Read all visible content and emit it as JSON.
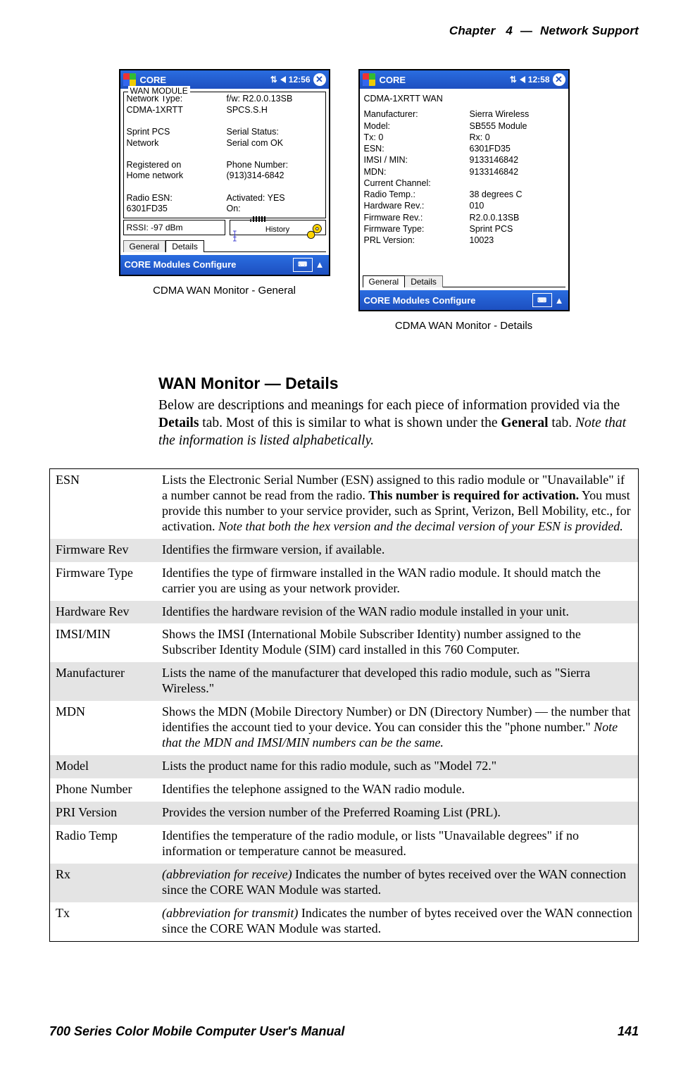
{
  "header": {
    "chapter_label": "Chapter",
    "chapter_num": "4",
    "dash": "—",
    "section": "Network Support"
  },
  "shots": {
    "general": {
      "titlebar": "CORE",
      "time": "12:56",
      "group_title": "WAN MODULE",
      "left_lines": [
        "Network Type:",
        "CDMA-1XRTT",
        "",
        "Sprint PCS",
        "Network",
        "",
        "Registered on",
        "Home network",
        "",
        "Radio ESN:",
        "6301FD35"
      ],
      "right_lines": [
        "f/w: R2.0.0.13SB",
        "    SPCS.S.H",
        "",
        "Serial Status:",
        "Serial com OK",
        "",
        "Phone Number:",
        "(913)314-6842",
        "",
        "Activated: YES",
        " On:"
      ],
      "rssi": "RSSI: -97 dBm",
      "hist_label": "History",
      "tab_general": "General",
      "tab_details": "Details",
      "footer": "CORE Modules Configure",
      "caption": "CDMA WAN Monitor - General"
    },
    "details": {
      "titlebar": "CORE",
      "time": "12:58",
      "heading": "CDMA-1XRTT WAN",
      "rows": [
        {
          "k": "Manufacturer:",
          "v": "Sierra Wireless"
        },
        {
          "k": "Model:",
          "v": "SB555 Module"
        },
        {
          "k": "Tx: 0",
          "v": "Rx: 0"
        },
        {
          "k": "ESN:",
          "v": "6301FD35"
        },
        {
          "k": "IMSI / MIN:",
          "v": "9133146842"
        },
        {
          "k": "MDN:",
          "v": "9133146842"
        },
        {
          "k": "Current Channel:",
          "v": ""
        },
        {
          "k": "Radio Temp.:",
          "v": "38 degrees C"
        },
        {
          "k": "Hardware Rev.:",
          "v": "010"
        },
        {
          "k": "Firmware Rev.:",
          "v": "R2.0.0.13SB"
        },
        {
          "k": "Firmware Type:",
          "v": "Sprint PCS"
        },
        {
          "k": "PRL Version:",
          "v": "10023"
        }
      ],
      "tab_general": "General",
      "tab_details": "Details",
      "footer": "CORE Modules Configure",
      "caption": "CDMA WAN Monitor - Details"
    }
  },
  "section_title": "WAN Monitor — Details",
  "body_html": "Below are descriptions and meanings for each piece of information provided via the <b>Details</b> tab. Most of this is similar to what is shown under the <b>General</b> tab. <i>Note that the information is listed alphabetically.</i>",
  "defs": [
    {
      "term": "ESN",
      "shade": false,
      "desc": "Lists the Electronic Serial Number (ESN) assigned to this radio module or \"Unavailable\" if a number cannot be read from the radio. <b>This number is required for activation.</b> You must provide this number to your service provider, such as Sprint, Verizon, Bell Mobility, etc., for activation. <i>Note that both the hex version and the decimal version of your ESN is provided.</i>"
    },
    {
      "term": "Firmware Rev",
      "shade": true,
      "desc": "Identifies the firmware version, if available."
    },
    {
      "term": "Firmware Type",
      "shade": false,
      "desc": "Identifies the type of firmware installed in the WAN radio module. It should match the carrier you are using as your network provider."
    },
    {
      "term": "Hardware Rev",
      "shade": true,
      "desc": "Identifies the hardware revision of the WAN radio module installed in your unit."
    },
    {
      "term": "IMSI/MIN",
      "shade": false,
      "desc": "Shows the IMSI (International Mobile Subscriber Identity) number assigned to the Subscriber Identity Module (SIM) card installed in this 760 Computer."
    },
    {
      "term": "Manufacturer",
      "shade": true,
      "desc": "Lists the name of the manufacturer that developed this radio module, such as \"Sierra Wireless.\""
    },
    {
      "term": "MDN",
      "shade": false,
      "desc": "Shows the MDN (Mobile Directory Number) or DN (Directory Number) — the number that identifies the account tied to your device. You can consider this the \"phone number.\" <i>Note that the MDN and IMSI/MIN numbers can be the same.</i>"
    },
    {
      "term": "Model",
      "shade": true,
      "desc": "Lists the product name for this radio module, such as \"Model 72.\""
    },
    {
      "term": "Phone Number",
      "shade": false,
      "desc": "Identifies the telephone assigned to the WAN radio module."
    },
    {
      "term": "PRI Version",
      "shade": true,
      "desc": "Provides the version number of the Preferred Roaming List (PRL)."
    },
    {
      "term": "Radio Temp",
      "shade": false,
      "desc": "Identifies the temperature of the radio module, or lists \"Unavailable degrees\" if no information or temperature cannot be measured."
    },
    {
      "term": "Rx",
      "shade": true,
      "desc": "<i>(abbreviation for receive)</i> Indicates the number of bytes received over the WAN connection since the CORE WAN Module was started."
    },
    {
      "term": "Tx",
      "shade": false,
      "desc": "<i>(abbreviation for transmit)</i> Indicates the number of bytes received over the WAN connection since the CORE WAN Module was started."
    }
  ],
  "footer": {
    "left": "700 Series Color Mobile Computer User's Manual",
    "right": "141"
  }
}
